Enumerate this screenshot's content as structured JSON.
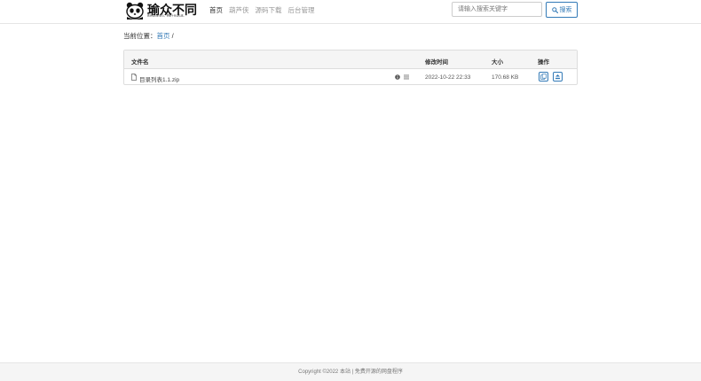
{
  "brand": {
    "name": "瑜众不同",
    "slogan": "做好自己的事心，把握十分自信感。"
  },
  "nav": {
    "items": [
      {
        "label": "首页",
        "active": true
      },
      {
        "label": "葫芦侠",
        "active": false
      },
      {
        "label": "源码下载",
        "active": false
      },
      {
        "label": "后台管理",
        "active": false
      }
    ]
  },
  "search": {
    "placeholder": "请输入搜索关键字",
    "button_label": "搜索",
    "icon": "search-icon"
  },
  "breadcrumb": {
    "prefix": "当前位置：",
    "home": "首页",
    "separator": "/"
  },
  "table": {
    "columns": {
      "name": "文件名",
      "modified": "修改时间",
      "size": "大小",
      "actions": "操作"
    },
    "rows": [
      {
        "name": "目录列表1.1.zip",
        "modified": "2022-10-22 22:33",
        "size": "170.68 KB"
      }
    ],
    "accent_color": "#337ab7"
  },
  "footer": {
    "text": "Copyright ©2022 本站 | 免费开源的网盘程序"
  }
}
